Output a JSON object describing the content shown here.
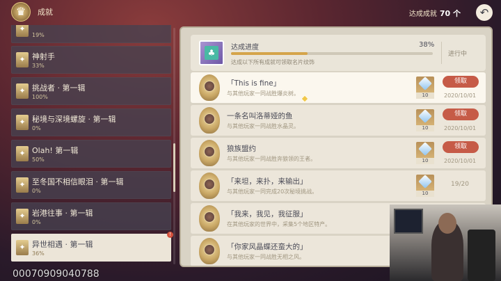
{
  "header": {
    "title": "成就",
    "total_label": "达成成就",
    "total_value": "70 个"
  },
  "sidebar": {
    "items": [
      {
        "name": "",
        "pct": "19%"
      },
      {
        "name": "神射手",
        "pct": "33%"
      },
      {
        "name": "挑战者 · 第一辑",
        "pct": "100%"
      },
      {
        "name": "秘境与深境螺旋 · 第一辑",
        "pct": "0%"
      },
      {
        "name": "Olah! 第一辑",
        "pct": "50%"
      },
      {
        "name": "至冬国不相信眼泪 · 第一辑",
        "pct": "0%"
      },
      {
        "name": "岩港往事 · 第一辑",
        "pct": "0%"
      },
      {
        "name": "异世相遇 · 第一辑",
        "pct": "36%"
      }
    ],
    "notice": "!",
    "watermark": "00070909040788"
  },
  "progress": {
    "title": "达成进度",
    "percent_label": "38%",
    "percent_value": 0.38,
    "description": "达成以下所有成就可领取名片纹饰",
    "status": "进行中"
  },
  "achievements": [
    {
      "title": "「This is fine」",
      "desc": "与其他玩家一同战胜爆炎树。",
      "reward_qty": "10",
      "button": "领取",
      "date": "2020/10/01",
      "progress": ""
    },
    {
      "title": "一条名叫洛蒂娅的鱼",
      "desc": "与其他玩家一同战胜水晶灵。",
      "reward_qty": "10",
      "button": "领取",
      "date": "2020/10/01",
      "progress": ""
    },
    {
      "title": "狼族盟约",
      "desc": "与其他玩家一同战胜奔狼领的王者。",
      "reward_qty": "10",
      "button": "领取",
      "date": "2020/10/01",
      "progress": ""
    },
    {
      "title": "「来坦，来扑，来输出」",
      "desc": "与其他玩家一同完成20次秘境挑战。",
      "reward_qty": "10",
      "button": "",
      "date": "",
      "progress": "19/20"
    },
    {
      "title": "「我来，我见，我征服」",
      "desc": "在其他玩家的世界中，采集5个地区特产。",
      "reward_qty": "",
      "button": "",
      "date": "",
      "progress": ""
    },
    {
      "title": "「你家风晶蝶还蛮大的」",
      "desc": "与其他玩家一同战胜无相之风。",
      "reward_qty": "",
      "button": "",
      "date": "",
      "progress": ""
    }
  ],
  "colors": {
    "accent_gold": "#d5a44a",
    "claim_red": "#c65b47",
    "panel_bg": "#d9d3c5"
  }
}
